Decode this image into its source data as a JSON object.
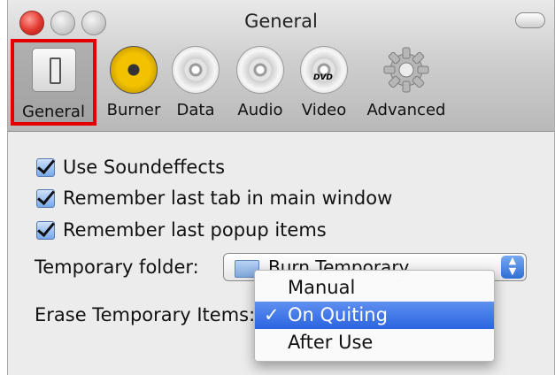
{
  "window": {
    "title": "General"
  },
  "toolbar": {
    "items": [
      {
        "label": "General",
        "icon": "switch-icon",
        "selected": true
      },
      {
        "label": "Burner",
        "icon": "burner-icon"
      },
      {
        "label": "Data",
        "icon": "disc-icon"
      },
      {
        "label": "Audio",
        "icon": "disc-icon"
      },
      {
        "label": "Video",
        "icon": "dvd-disc-icon",
        "disc_text": "DVD"
      },
      {
        "label": "Advanced",
        "icon": "gear-icon"
      }
    ]
  },
  "options": {
    "checkboxes": [
      {
        "label": "Use Soundeffects",
        "checked": true
      },
      {
        "label": "Remember last tab in main window",
        "checked": true
      },
      {
        "label": "Remember last popup items",
        "checked": true
      }
    ],
    "temporary_folder": {
      "label": "Temporary folder:",
      "value": "Burn Temporary"
    },
    "erase_temporary_items": {
      "label": "Erase Temporary Items:"
    }
  },
  "popup_menu": {
    "items": [
      {
        "label": "Manual",
        "selected": false
      },
      {
        "label": "On Quiting",
        "selected": true
      },
      {
        "label": "After Use",
        "selected": false
      }
    ],
    "check_glyph": "✓"
  },
  "colors": {
    "highlight": "#e40000",
    "menu_selection": "#2a64e0"
  }
}
